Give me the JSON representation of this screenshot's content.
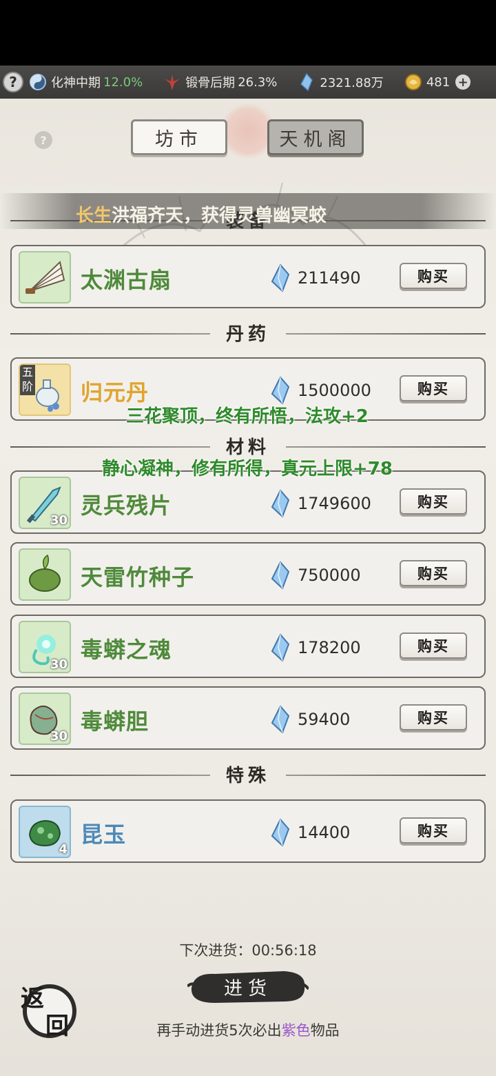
{
  "status_bar": {
    "help": "?",
    "realm": "化神中期",
    "realm_percent": "12.0%",
    "body": "锻骨后期",
    "body_percent": "26.3%",
    "spirit_stones": "2321.88万",
    "gold": "481",
    "plus": "+"
  },
  "tabs": {
    "market": "坊市",
    "tianjige": "天机阁"
  },
  "help_small": "?",
  "banner": {
    "gold_part": "长生",
    "text": "洪福齐天，获得灵兽幽冥蛟"
  },
  "sections": {
    "equipment": "装备",
    "pills": "丹药",
    "materials": "材料",
    "special": "特殊"
  },
  "items": [
    {
      "name": "太渊古扇",
      "price": "211490",
      "buy": "购买",
      "icon": "fan-icon"
    },
    {
      "name": "归元丹",
      "price": "1500000",
      "buy": "购买",
      "tier": "五阶",
      "icon": "pill-bottle-icon"
    },
    {
      "name": "灵兵残片",
      "price": "1749600",
      "buy": "购买",
      "count": "30",
      "icon": "blade-shard-icon"
    },
    {
      "name": "天雷竹种子",
      "price": "750000",
      "buy": "购买",
      "icon": "seed-icon"
    },
    {
      "name": "毒蟒之魂",
      "price": "178200",
      "buy": "购买",
      "count": "30",
      "icon": "soul-wisp-icon"
    },
    {
      "name": "毒蟒胆",
      "price": "59400",
      "buy": "购买",
      "count": "30",
      "icon": "gallbladder-icon"
    },
    {
      "name": "昆玉",
      "price": "14400",
      "buy": "购买",
      "count": "4",
      "icon": "jade-icon"
    }
  ],
  "notices": {
    "first": "三花聚顶，终有所悟，法攻+2",
    "second": "静心凝神，修有所得，真元上限+78"
  },
  "restock": {
    "timer_label": "下次进货：00:56:18",
    "button": "进货",
    "hint_prefix": "再手动进货5次必出",
    "hint_purple": "紫色",
    "hint_suffix": "物品"
  },
  "back": {
    "top": "返",
    "bottom": "回"
  },
  "colors": {
    "green_name": "#4f8a3b",
    "gold_name": "#e0a42e",
    "blue_name": "#4b89b8",
    "purple": "#9b58c9"
  }
}
